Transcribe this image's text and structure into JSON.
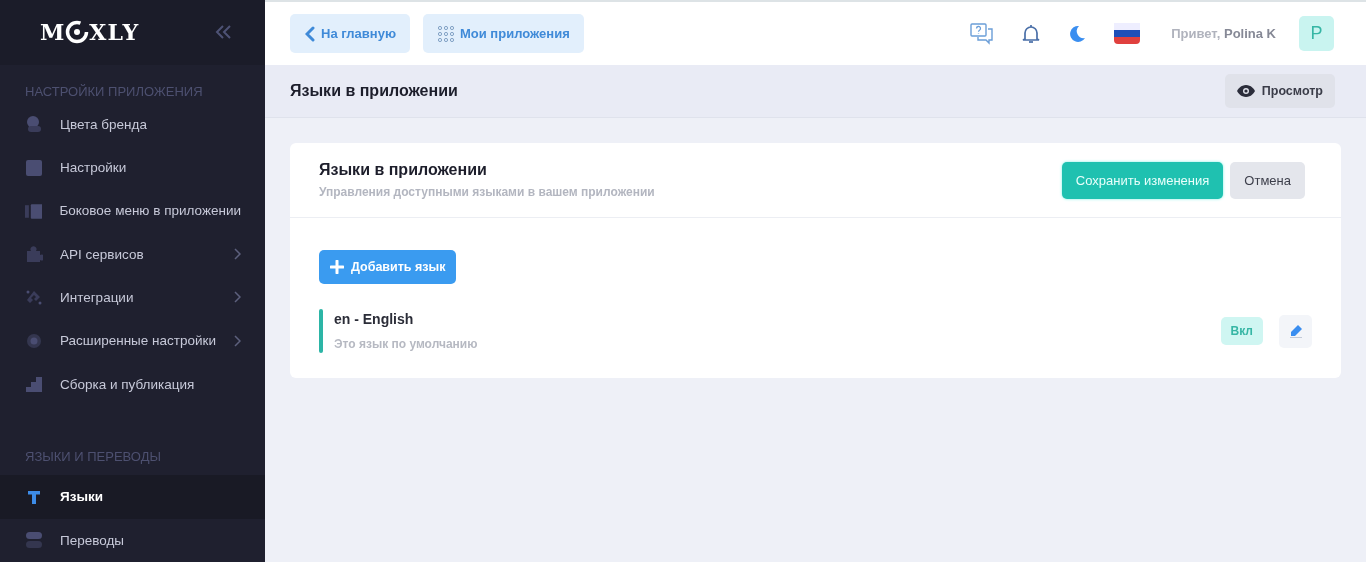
{
  "sidebar": {
    "logo": {
      "before": "M",
      "after": "XLY"
    },
    "sections": [
      {
        "title": "НАСТРОЙКИ ПРИЛОЖЕНИЯ",
        "items": [
          {
            "label": "Цвета бренда",
            "submenu": false,
            "selected": false
          },
          {
            "label": "Настройки",
            "submenu": false,
            "selected": false
          },
          {
            "label": "Боковое меню в приложении",
            "submenu": false,
            "selected": false
          },
          {
            "label": "API сервисов",
            "submenu": true,
            "selected": false
          },
          {
            "label": "Интеграции",
            "submenu": true,
            "selected": false
          },
          {
            "label": "Расширенные настройки",
            "submenu": true,
            "selected": false
          },
          {
            "label": "Сборка и публикация",
            "submenu": false,
            "selected": false
          }
        ]
      },
      {
        "title": "ЯЗЫКИ И ПЕРЕВОДЫ",
        "items": [
          {
            "label": "Языки",
            "submenu": false,
            "selected": true
          },
          {
            "label": "Переводы",
            "submenu": false,
            "selected": false
          }
        ]
      }
    ]
  },
  "topbar": {
    "nav_buttons": [
      {
        "label": "На главную"
      },
      {
        "label": "Мои приложения"
      }
    ],
    "greeting": "Привет,",
    "user_name": "Polina K",
    "avatar": "P"
  },
  "page_header": {
    "title": "Языки в приложении",
    "preview_button": "Просмотр"
  },
  "card": {
    "title": "Языки в приложении",
    "subtitle": "Управления доступными языками в вашем приложении",
    "save_button": "Сохранить изменения",
    "cancel_button": "Отмена",
    "add_button": "Добавить язык",
    "languages": [
      {
        "name": "en - English",
        "note": "Это язык по умолчанию",
        "enabled": true,
        "status": "Вкл"
      }
    ]
  }
}
